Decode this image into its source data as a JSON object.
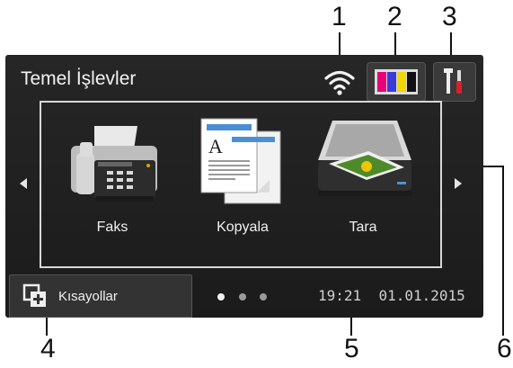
{
  "callouts": [
    "1",
    "2",
    "3",
    "4",
    "5",
    "6"
  ],
  "header": {
    "title": "Temel İşlevler"
  },
  "status_icons": {
    "wifi": "wifi-icon",
    "ink": "ink-cartridges-icon",
    "settings": "tools-icon"
  },
  "ink_colors": [
    "#e8007a",
    "#3a3ad9",
    "#f2d600",
    "#111111"
  ],
  "tiles": [
    {
      "label": "Faks",
      "icon": "fax-machine-icon"
    },
    {
      "label": "Kopyala",
      "icon": "copy-documents-icon"
    },
    {
      "label": "Tara",
      "icon": "scanner-icon"
    }
  ],
  "footer": {
    "shortcuts_label": "Kısayollar",
    "time": "19:21",
    "date": "01.01.2015",
    "page_indicator": {
      "count": 3,
      "active": 0
    }
  }
}
